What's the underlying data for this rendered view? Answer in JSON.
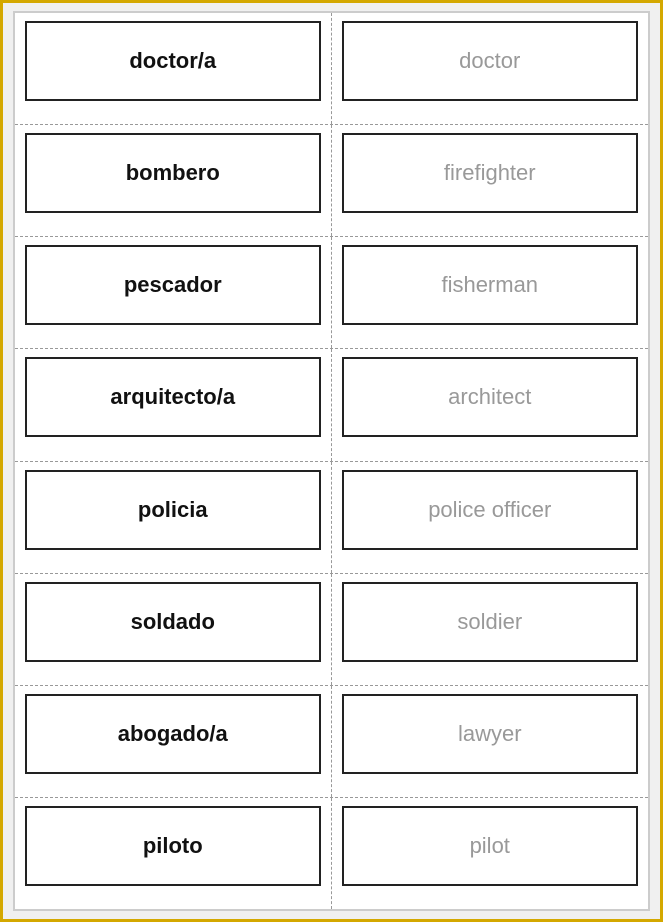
{
  "border_color": "#d4a800",
  "rows": [
    {
      "spanish": "doctor/a",
      "english": "doctor"
    },
    {
      "spanish": "bombero",
      "english": "firefighter"
    },
    {
      "spanish": "pescador",
      "english": "fisherman"
    },
    {
      "spanish": "arquitecto/a",
      "english": "architect"
    },
    {
      "spanish": "policia",
      "english": "police officer"
    },
    {
      "spanish": "soldado",
      "english": "soldier"
    },
    {
      "spanish": "abogado/a",
      "english": "lawyer"
    },
    {
      "spanish": "piloto",
      "english": "pilot"
    }
  ]
}
